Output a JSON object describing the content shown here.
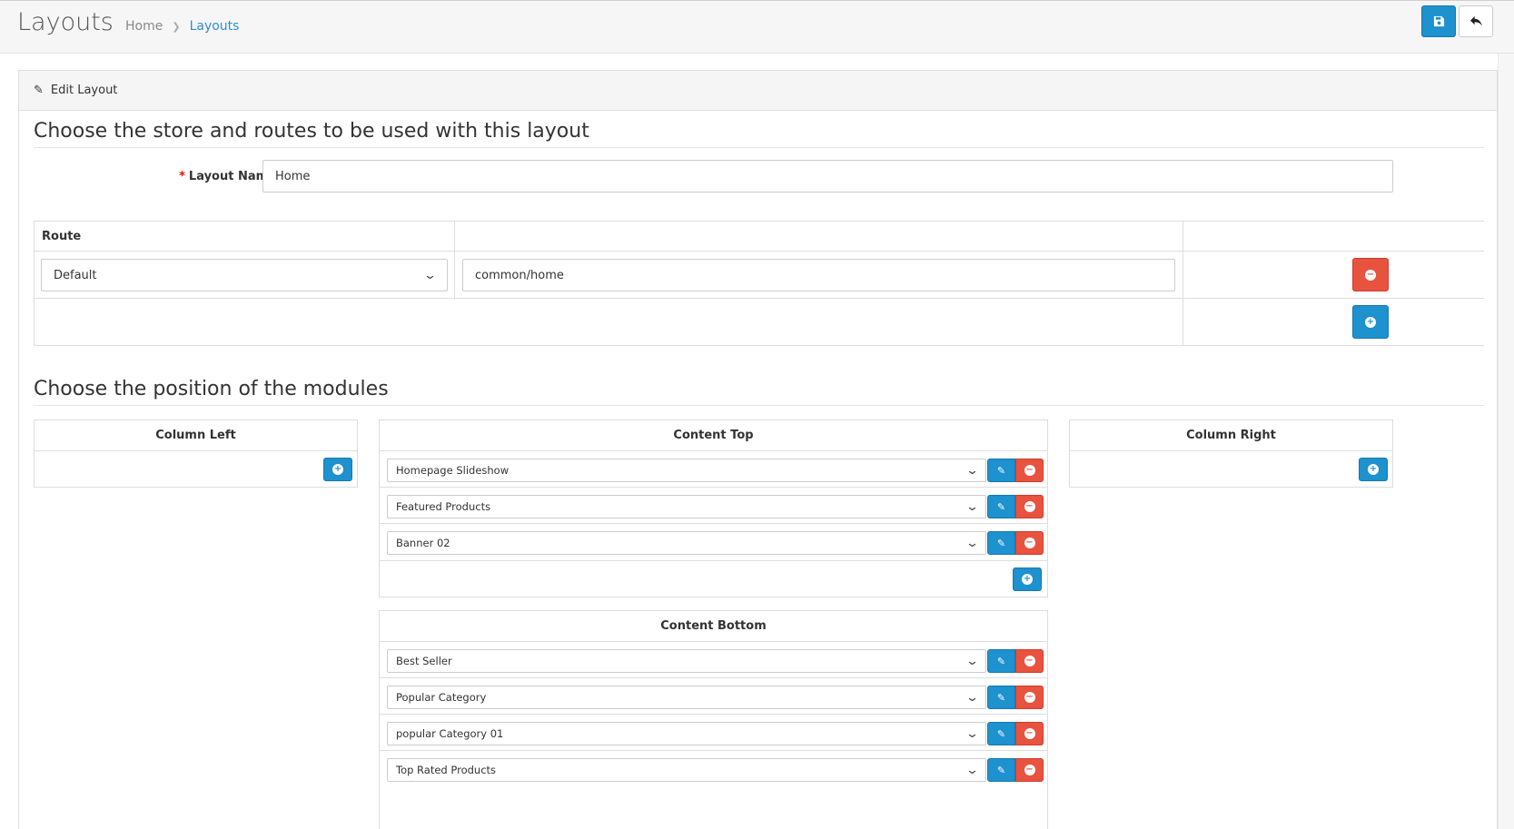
{
  "header": {
    "title": "Layouts",
    "breadcrumb": [
      "Home",
      "Layouts"
    ],
    "save_icon": "save-icon",
    "back_icon": "reply-icon"
  },
  "panel": {
    "heading": "Edit Layout",
    "heading_icon": "pencil-icon"
  },
  "store_section": {
    "title": "Choose the store and routes to be used with this layout",
    "layout_name_label": "Layout Name",
    "layout_name_value": "Home"
  },
  "route_table": {
    "header": "Route",
    "rows": [
      {
        "store": "Default",
        "route": "common/home"
      }
    ]
  },
  "modules_section": {
    "title": "Choose the position of the modules",
    "column_left": {
      "label": "Column Left"
    },
    "content_top": {
      "label": "Content Top",
      "modules": [
        "Homepage Slideshow",
        "Featured Products",
        "Banner 02"
      ]
    },
    "column_right": {
      "label": "Column Right"
    },
    "content_bottom": {
      "label": "Content Bottom",
      "modules": [
        "Best Seller",
        "Popular Category",
        "popular Category 01",
        "Top Rated Products"
      ]
    }
  },
  "colors": {
    "primary": "#1e91cf",
    "danger": "#e8533f",
    "link": "#2c8fd0"
  }
}
